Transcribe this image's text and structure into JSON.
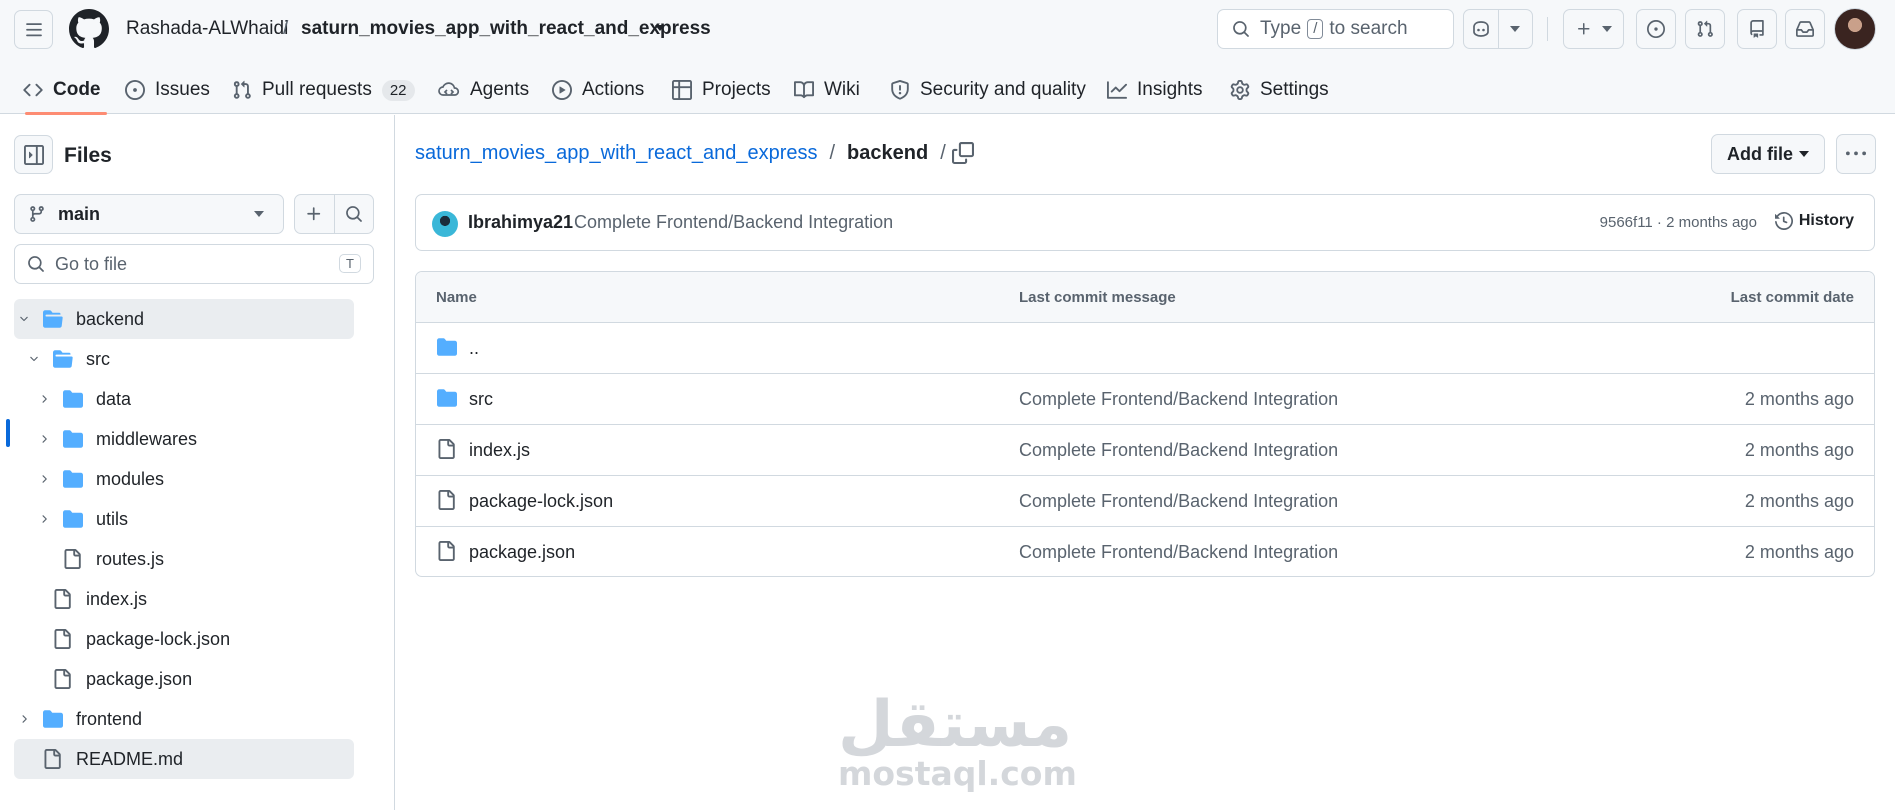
{
  "header": {
    "owner": "Rashada-ALWhaidi",
    "separator": "/",
    "repo": "saturn_movies_app_with_react_and_express",
    "search_prefix": "Type",
    "search_key": "/",
    "search_suffix": "to search",
    "icons": [
      "hamburger-icon",
      "github-logo-icon",
      "search-icon",
      "copilot-icon",
      "plus-icon",
      "issues-icon",
      "pull-requests-icon",
      "repos-icon",
      "inbox-icon"
    ]
  },
  "tabs": [
    {
      "label": "Code",
      "icon": "code-icon",
      "selected": true
    },
    {
      "label": "Issues",
      "icon": "issue-opened-icon"
    },
    {
      "label": "Pull requests",
      "icon": "git-pull-request-icon",
      "count": "22"
    },
    {
      "label": "Agents",
      "icon": "agents-icon"
    },
    {
      "label": "Actions",
      "icon": "play-icon"
    },
    {
      "label": "Projects",
      "icon": "table-icon"
    },
    {
      "label": "Wiki",
      "icon": "book-icon"
    },
    {
      "label": "Security and quality",
      "icon": "shield-icon"
    },
    {
      "label": "Insights",
      "icon": "graph-icon"
    },
    {
      "label": "Settings",
      "icon": "gear-icon"
    }
  ],
  "sidebar": {
    "title": "Files",
    "branch": "main",
    "goto_placeholder": "Go to file",
    "goto_key": "T",
    "tree": [
      {
        "label": "backend",
        "type": "folder",
        "open": true,
        "active": true
      },
      {
        "label": "src",
        "type": "folder",
        "open": true
      },
      {
        "label": "data",
        "type": "folder"
      },
      {
        "label": "middlewares",
        "type": "folder"
      },
      {
        "label": "modules",
        "type": "folder"
      },
      {
        "label": "utils",
        "type": "folder"
      },
      {
        "label": "routes.js",
        "type": "file"
      },
      {
        "label": "index.js",
        "type": "file"
      },
      {
        "label": "package-lock.json",
        "type": "file"
      },
      {
        "label": "package.json",
        "type": "file"
      },
      {
        "label": "frontend",
        "type": "folder"
      },
      {
        "label": "README.md",
        "type": "file"
      }
    ]
  },
  "main": {
    "path_repo": "saturn_movies_app_with_react_and_express",
    "path_sep": "/",
    "path_current": "backend",
    "add_file_label": "Add file",
    "commit": {
      "author": "Ibrahimya21",
      "message": "Complete Frontend/Backend Integration",
      "meta": "9566f11 · 2 months ago",
      "history_label": "History"
    },
    "table": {
      "col_name": "Name",
      "col_msg": "Last commit message",
      "col_date": "Last commit date",
      "parent": "..",
      "rows": [
        {
          "name": "src",
          "type": "folder",
          "message": "Complete Frontend/Backend Integration",
          "date": "2 months ago"
        },
        {
          "name": "index.js",
          "type": "file",
          "message": "Complete Frontend/Backend Integration",
          "date": "2 months ago"
        },
        {
          "name": "package-lock.json",
          "type": "file",
          "message": "Complete Frontend/Backend Integration",
          "date": "2 months ago"
        },
        {
          "name": "package.json",
          "type": "file",
          "message": "Complete Frontend/Backend Integration",
          "date": "2 months ago"
        }
      ]
    }
  },
  "watermark": {
    "arabic": "مستقل",
    "latin": "mostaql.com"
  },
  "colors": {
    "accent": "#0969da",
    "tab_underline": "#fd8c73",
    "folder": "#54aeff",
    "border": "#d1d9e0"
  }
}
